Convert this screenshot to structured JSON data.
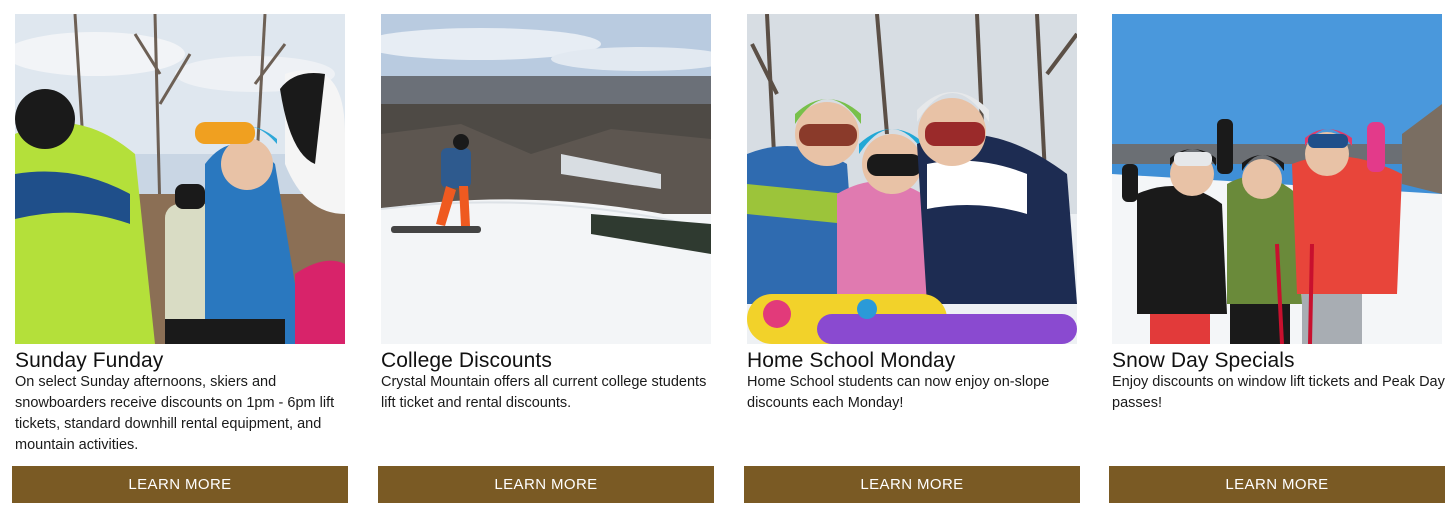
{
  "cards": [
    {
      "title": "Sunday Funday",
      "description": "On select Sunday afternoons, skiers and snowboarders receive discounts on 1pm - 6pm lift tickets, standard downhill rental equipment, and mountain activities.",
      "button_label": "LEARN MORE",
      "image": "photo of skiers and snowboarder smiling on slope"
    },
    {
      "title": "College Discounts",
      "description": "Crystal Mountain offers all current college students lift ticket and rental discounts.",
      "button_label": "LEARN MORE",
      "image": "photo of snowboarder at top of hill overlooking valley"
    },
    {
      "title": "Home School Monday",
      "description": "Home School students can now enjoy on-slope discounts each Monday!",
      "button_label": "LEARN MORE",
      "image": "photo of three kids in helmets and goggles with snowboard"
    },
    {
      "title": "Snow Day Specials",
      "description": "Enjoy discounts on window lift tickets and Peak Day passes!",
      "button_label": "LEARN MORE",
      "image": "photo of four kids waving on snowy slope"
    }
  ],
  "colors": {
    "button_bg": "#7a5a24",
    "button_text": "#ffffff",
    "text": "#111111"
  }
}
